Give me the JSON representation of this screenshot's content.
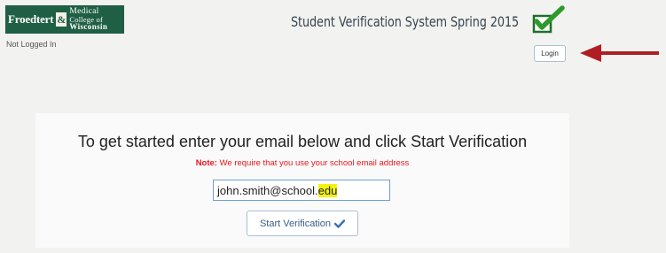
{
  "logo": {
    "froedtert": "Froedtert",
    "ampersand": "&",
    "line1": "Medical",
    "line2": "College of",
    "line3": "Wisconsin"
  },
  "header": {
    "status": "Not Logged In",
    "title": "Student Verification System Spring 2015",
    "badge_icon": "checkbox-check-icon",
    "login_label": "Login"
  },
  "main": {
    "instruction": "To get started enter your email below and click Start Verification",
    "note_label": "Note:",
    "note_text": "We require that you use your school email address",
    "email_value_prefix": "john.smith@school.",
    "email_value_highlight": "edu",
    "start_label": "Start Verification",
    "start_icon": "check-icon"
  },
  "colors": {
    "logo_green": "#1f5f45",
    "note_red": "#e8161b",
    "highlight_yellow": "#f3f20f",
    "arrow_red": "#b01e23",
    "check_green": "#2e9a2a"
  }
}
